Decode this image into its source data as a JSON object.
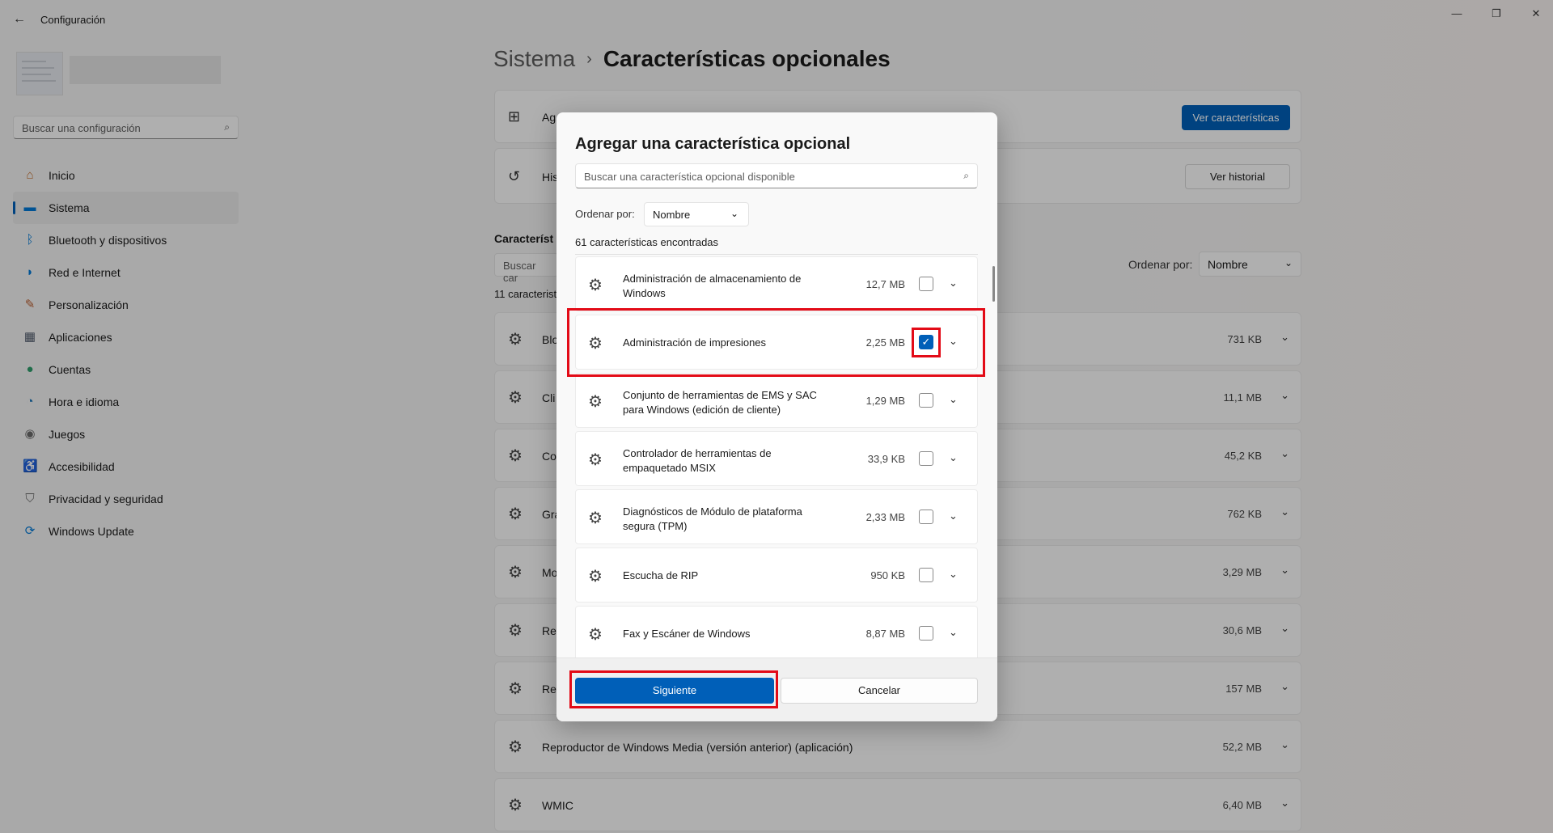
{
  "window": {
    "title": "Configuración",
    "back_icon": "back-arrow-icon",
    "minimize": "—",
    "maximize": "❐",
    "close": "✕"
  },
  "sidebar": {
    "search_placeholder": "Buscar una configuración",
    "items": [
      {
        "label": "Inicio",
        "icon": "home-icon",
        "glyph": "⌂",
        "color": "#c26d2d"
      },
      {
        "label": "Sistema",
        "icon": "system-icon",
        "glyph": "▬",
        "color": "#0078d4",
        "active": true
      },
      {
        "label": "Bluetooth y dispositivos",
        "icon": "bluetooth-icon",
        "glyph": "ᛒ",
        "color": "#0078d4"
      },
      {
        "label": "Red e Internet",
        "icon": "wifi-icon",
        "glyph": "◗",
        "color": "#0078d4"
      },
      {
        "label": "Personalización",
        "icon": "brush-icon",
        "glyph": "✎",
        "color": "#b85c2e"
      },
      {
        "label": "Aplicaciones",
        "icon": "apps-icon",
        "glyph": "▦",
        "color": "#4f5a6b"
      },
      {
        "label": "Cuentas",
        "icon": "account-icon",
        "glyph": "●",
        "color": "#2e9c6a"
      },
      {
        "label": "Hora e idioma",
        "icon": "globe-clock-icon",
        "glyph": "◔",
        "color": "#1f74b5"
      },
      {
        "label": "Juegos",
        "icon": "gamepad-icon",
        "glyph": "◉",
        "color": "#6b6b6b"
      },
      {
        "label": "Accesibilidad",
        "icon": "accessibility-icon",
        "glyph": "♿",
        "color": "#1f74b5"
      },
      {
        "label": "Privacidad y seguridad",
        "icon": "shield-icon",
        "glyph": "⛉",
        "color": "#6b6b6b"
      },
      {
        "label": "Windows Update",
        "icon": "update-icon",
        "glyph": "⟳",
        "color": "#0078d4"
      }
    ]
  },
  "breadcrumb": {
    "parent": "Sistema",
    "separator": "›",
    "current": "Características opcionales"
  },
  "main": {
    "add_card": {
      "text": "Ag",
      "button": "Ver características"
    },
    "history_card": {
      "text": "His",
      "button": "Ver historial"
    },
    "section_title": "Característ",
    "filter_placeholder": "Buscar car",
    "count": "11 caracterist",
    "sort_label": "Ordenar por:",
    "sort_value": "Nombre",
    "features": [
      {
        "name": "Blo",
        "size": "731 KB"
      },
      {
        "name": "Cli",
        "size": "11,1 MB"
      },
      {
        "name": "Co",
        "size": "45,2 KB"
      },
      {
        "name": "Gra",
        "size": "762 KB"
      },
      {
        "name": "Mo",
        "size": "3,29 MB"
      },
      {
        "name": "Re",
        "size": "30,6 MB"
      },
      {
        "name": "Re",
        "size": "157 MB"
      },
      {
        "name": "Reproductor de Windows Media (versión anterior) (aplicación)",
        "size": "52,2 MB"
      },
      {
        "name": "WMIC",
        "size": "6,40 MB"
      }
    ]
  },
  "dialog": {
    "title": "Agregar una característica opcional",
    "search_placeholder": "Buscar una característica opcional disponible",
    "sort_label": "Ordenar por:",
    "sort_value": "Nombre",
    "count": "61 características encontradas",
    "items": [
      {
        "name": "Administración de almacenamiento de Windows",
        "size": "12,7 MB",
        "checked": false
      },
      {
        "name": "Administración de impresiones",
        "size": "2,25 MB",
        "checked": true
      },
      {
        "name": "Conjunto de herramientas de EMS y SAC para Windows (edición de cliente)",
        "size": "1,29 MB",
        "checked": false
      },
      {
        "name": "Controlador de herramientas de empaquetado MSIX",
        "size": "33,9 KB",
        "checked": false
      },
      {
        "name": "Diagnósticos de Módulo de plataforma segura (TPM)",
        "size": "2,33 MB",
        "checked": false
      },
      {
        "name": "Escucha de RIP",
        "size": "950 KB",
        "checked": false
      },
      {
        "name": "Fax y Escáner de Windows",
        "size": "8,87 MB",
        "checked": false
      }
    ],
    "next_button": "Siguiente",
    "cancel_button": "Cancelar"
  },
  "colors": {
    "accent": "#005fb8",
    "highlight": "#e30b17"
  }
}
